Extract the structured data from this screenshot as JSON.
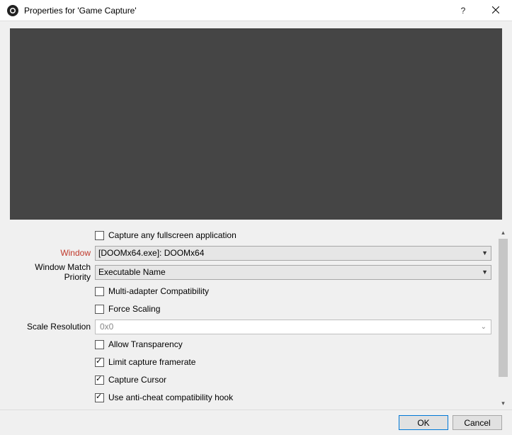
{
  "titlebar": {
    "title": "Properties for 'Game Capture'"
  },
  "form": {
    "capture_fullscreen": {
      "label": "Capture any fullscreen application",
      "checked": false
    },
    "window": {
      "label": "Window",
      "value": "[DOOMx64.exe]: DOOMx64"
    },
    "match_priority": {
      "label": "Window Match Priority",
      "value": "Executable Name"
    },
    "multi_adapter": {
      "label": "Multi-adapter Compatibility",
      "checked": false
    },
    "force_scaling": {
      "label": "Force Scaling",
      "checked": false
    },
    "scale_resolution": {
      "label": "Scale Resolution",
      "value": "0x0"
    },
    "allow_transparency": {
      "label": "Allow Transparency",
      "checked": false
    },
    "limit_framerate": {
      "label": "Limit capture framerate",
      "checked": true
    },
    "capture_cursor": {
      "label": "Capture Cursor",
      "checked": true
    },
    "anti_cheat_hook": {
      "label": "Use anti-cheat compatibility hook",
      "checked": true
    }
  },
  "footer": {
    "ok": "OK",
    "cancel": "Cancel"
  }
}
